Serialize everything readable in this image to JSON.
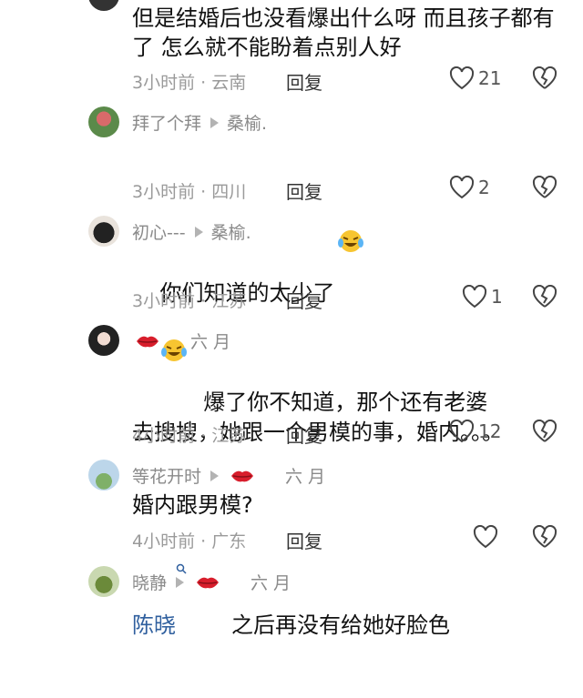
{
  "comments": [
    {
      "author": "",
      "reply_to": "",
      "text": "但是结婚后也没看爆出什么呀 而且孩子都有了 怎么就不能盼着点别人好",
      "time_location": "3小时前 · 云南",
      "reply_label": "回复",
      "likes": "21"
    },
    {
      "author": "拜了个拜",
      "reply_to": "桑榆.",
      "text": "你们知道的太少了",
      "time_location": "3小时前 · 四川",
      "reply_label": "回复",
      "likes": "2"
    },
    {
      "author": "初心---",
      "reply_to": "桑榆.",
      "text": "爆了你不知道，那个还有老婆",
      "time_location": "3小时前 · 江苏",
      "reply_label": "回复",
      "likes": "1"
    },
    {
      "author": "六 月",
      "reply_to": "",
      "text_line1": "去搜搜，她跟一个男模的事，婚内。。。",
      "mention": "陈晓",
      "text_line2_rest": "之后再没有给她好脸色",
      "time_location": "4小时前 · 江苏",
      "reply_label": "回复",
      "likes": "12"
    },
    {
      "author": "等花开时",
      "reply_to": "六 月",
      "text": "婚内跟男模?",
      "time_location": "4小时前 · 广东",
      "reply_label": "回复",
      "likes": ""
    },
    {
      "author": "晓静",
      "reply_to": "六 月",
      "text": "",
      "time_location": "",
      "reply_label": "",
      "likes": ""
    }
  ],
  "colors": {
    "mention": "#2f5f9e",
    "meta_gray": "#9a9a9a",
    "lips_red": "#d81e2c"
  }
}
